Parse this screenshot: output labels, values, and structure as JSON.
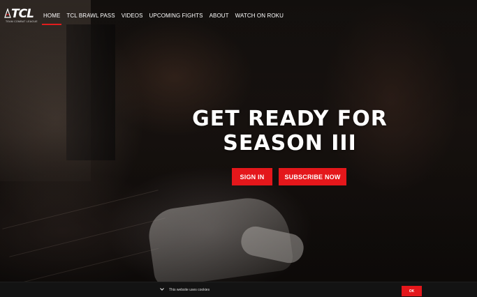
{
  "brand": {
    "logo_text": "TCL",
    "logo_subtext": "TEAM COMBAT LEAGUE",
    "accent_color": "#e4171b"
  },
  "nav": {
    "items": [
      {
        "label": "HOME",
        "active": true
      },
      {
        "label": "TCL BRAWL PASS",
        "active": false
      },
      {
        "label": "VIDEOS",
        "active": false
      },
      {
        "label": "UPCOMING FIGHTS",
        "active": false
      },
      {
        "label": "ABOUT",
        "active": false
      },
      {
        "label": "WATCH ON ROKU",
        "active": false
      }
    ]
  },
  "hero": {
    "headline_line1": "GET READY FOR",
    "headline_line2": "SEASON III",
    "signin_label": "SIGN IN",
    "subscribe_label": "SUBSCRIBE NOW"
  },
  "cookie": {
    "message": "This website uses cookies",
    "ok_label": "OK",
    "chevron_icon": "chevron-down-icon"
  }
}
